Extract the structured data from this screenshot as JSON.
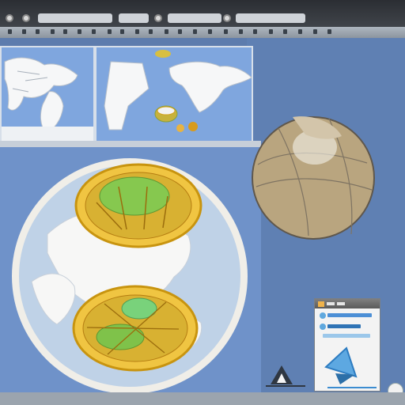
{
  "window": {
    "title_buttons": [
      "",
      "",
      ""
    ]
  },
  "colors": {
    "ocean": "#7fa6de",
    "land": "#f5f6f7",
    "globe_shell": "#f0eee8",
    "dish_rim": "#d5a426",
    "dish_center": "#79c24a",
    "tan_globe": "#b9a57f",
    "accent_blue": "#4c8fd6"
  },
  "icons": [
    "app-icon",
    "settings-icon",
    "globe-icon",
    "map-icon",
    "triangle-shape-icon",
    "landmark-icon",
    "circle-button-icon"
  ]
}
